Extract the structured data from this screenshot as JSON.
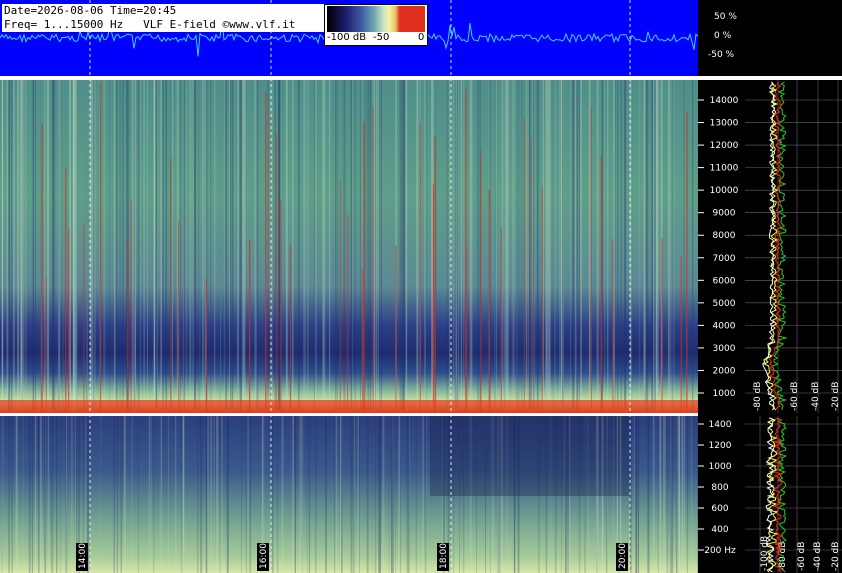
{
  "header": {
    "line1": "Date=2026-08-06 Time=20:45",
    "line2": "Freq= 1...15000 Hz   VLF E-field ©www.vlf.it"
  },
  "color_scale": {
    "labels": [
      "-100 dB",
      "-50",
      "0"
    ]
  },
  "waveform": {
    "percent_labels": [
      "50 %",
      "0 %",
      "-50 %"
    ],
    "background": "#0000ff",
    "trace": "#3fd0ff"
  },
  "upper_panel": {
    "freq_ticks": [
      "14000",
      "13000",
      "12000",
      "11000",
      "10000",
      "9000",
      "8000",
      "7000",
      "6000",
      "5000",
      "4000",
      "3000",
      "2000",
      "1000"
    ],
    "db_labels": [
      "-80 dB",
      "-60 dB",
      "-40 dB",
      "-20 dB"
    ]
  },
  "lower_panel": {
    "freq_ticks": [
      "1400",
      "1200",
      "1000",
      "800",
      "600",
      "400",
      "200 Hz"
    ],
    "db_labels": [
      "-100 dB",
      "-80 dB",
      "-60 dB",
      "-40 dB",
      "-20 dB"
    ]
  },
  "time_labels": [
    "14:00",
    "16:00",
    "18:00",
    "20:00"
  ],
  "spectrum_colors": {
    "white": "#ffffff",
    "yellow": "#ffff40",
    "red": "#ff2020",
    "green": "#20d020"
  }
}
